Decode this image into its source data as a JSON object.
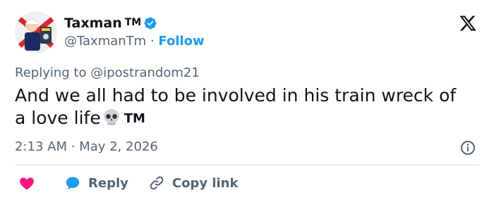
{
  "author": {
    "name": "Taxman",
    "name_suffix": "TM",
    "handle": "@TaxmanTm",
    "separator": "·",
    "follow_label": "Follow"
  },
  "reply_to": {
    "prefix": "Replying to",
    "mention": "@ipostrandom21"
  },
  "tweet": {
    "line1": "And we all had to be involved in his train wreck of",
    "line2_start": "a love life",
    "line2_end": "TM",
    "emoji": "skull"
  },
  "meta": {
    "time": "2:13 AM",
    "separator": "·",
    "date": "May 2, 2026"
  },
  "actions": {
    "reply_label": "Reply",
    "copy_label": "Copy link"
  },
  "colors": {
    "accent": "#1d9bf0",
    "heart": "#f91880",
    "secondary_text": "#536471",
    "primary_text": "#0f1419"
  },
  "icons": [
    "verified-badge-icon",
    "x-logo-icon",
    "skull-emoji-icon",
    "info-icon",
    "heart-icon",
    "reply-bubble-icon",
    "link-icon"
  ]
}
